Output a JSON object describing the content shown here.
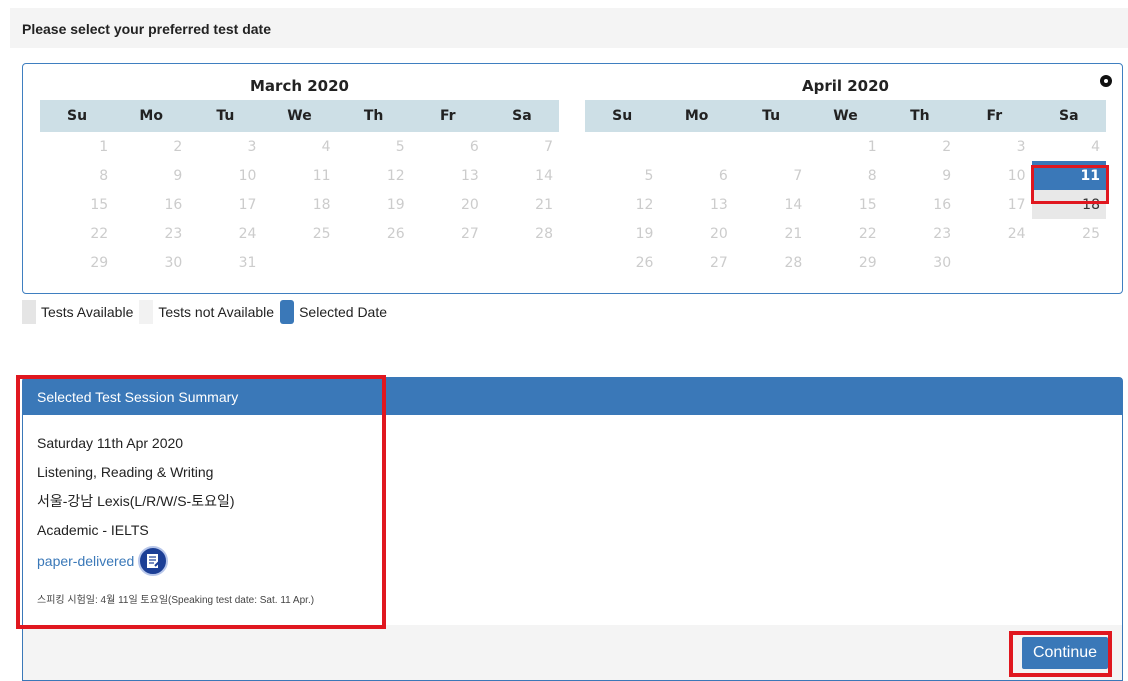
{
  "header": {
    "title": "Please select your preferred test date"
  },
  "calendar": {
    "months": [
      {
        "title": "March 2020",
        "weekdays": [
          "Su",
          "Mo",
          "Tu",
          "We",
          "Th",
          "Fr",
          "Sa"
        ],
        "weeks": [
          [
            "1",
            "2",
            "3",
            "4",
            "5",
            "6",
            "7"
          ],
          [
            "8",
            "9",
            "10",
            "11",
            "12",
            "13",
            "14"
          ],
          [
            "15",
            "16",
            "17",
            "18",
            "19",
            "20",
            "21"
          ],
          [
            "22",
            "23",
            "24",
            "25",
            "26",
            "27",
            "28"
          ],
          [
            "29",
            "30",
            "31",
            "",
            "",
            "",
            ""
          ]
        ]
      },
      {
        "title": "April 2020",
        "weekdays": [
          "Su",
          "Mo",
          "Tu",
          "We",
          "Th",
          "Fr",
          "Sa"
        ],
        "weeks": [
          [
            "",
            "",
            "",
            "1",
            "2",
            "3",
            "4"
          ],
          [
            "5",
            "6",
            "7",
            "8",
            "9",
            "10",
            "11"
          ],
          [
            "12",
            "13",
            "14",
            "15",
            "16",
            "17",
            "18"
          ],
          [
            "19",
            "20",
            "21",
            "22",
            "23",
            "24",
            "25"
          ],
          [
            "26",
            "27",
            "28",
            "29",
            "30",
            "",
            ""
          ]
        ],
        "selected": "11",
        "available": [
          "18"
        ]
      }
    ],
    "next_icon": "next-month-icon"
  },
  "legend": {
    "available": "Tests Available",
    "not_available": "Tests not Available",
    "selected": "Selected Date"
  },
  "summary": {
    "heading": "Selected Test Session Summary",
    "date": "Saturday 11th Apr 2020",
    "modules": "Listening, Reading & Writing",
    "venue": "서울-강남 Lexis(L/R/W/S-토요일)",
    "test_type": "Academic - IELTS",
    "delivery": "paper-delivered",
    "delivery_icon": "document-icon",
    "speaking_note": "스피킹 시험일: 4월 11일 토요일(Speaking test date: Sat. 11 Apr.)"
  },
  "footer": {
    "continue_label": "Continue"
  },
  "colors": {
    "accent": "#3a78b8",
    "header_cells": "#cddfe6",
    "highlight": "#e0171f"
  }
}
